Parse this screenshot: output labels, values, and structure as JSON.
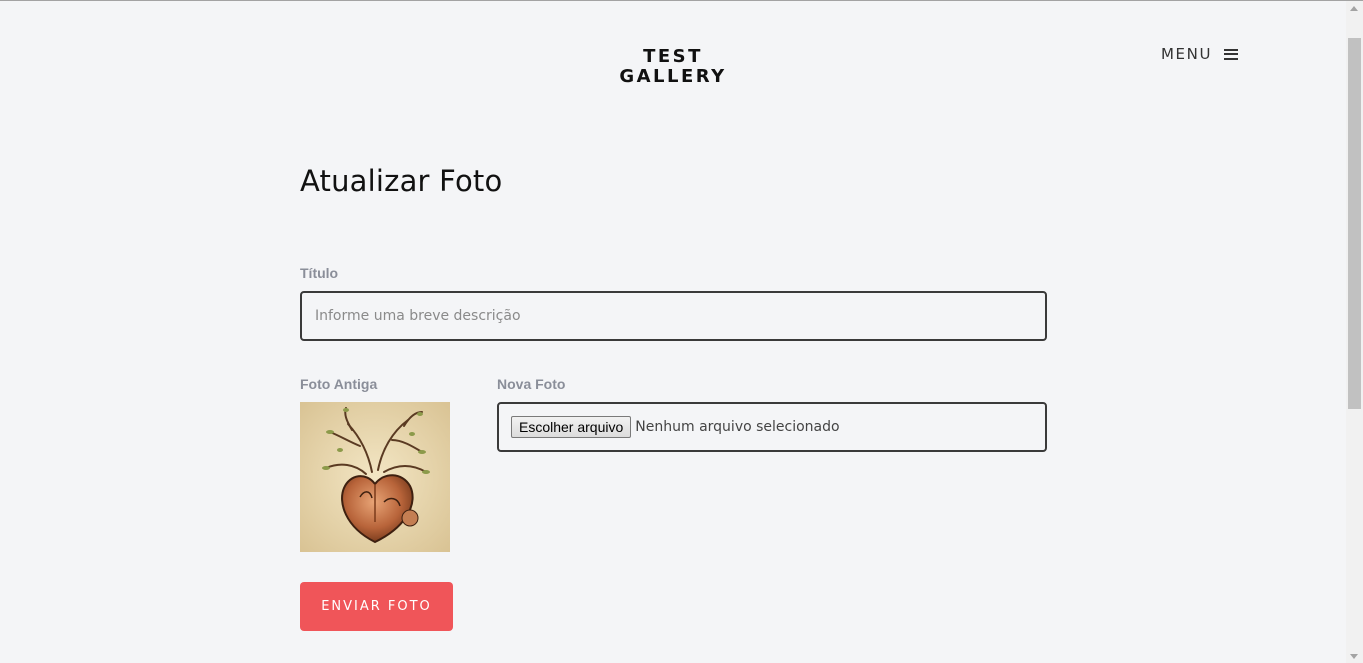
{
  "header": {
    "logo_line1": "TEST",
    "logo_line2": "GALLERY",
    "menu_label": "MENU",
    "menu_icon": "hamburger-menu-icon"
  },
  "main": {
    "page_title": "Atualizar Foto",
    "titulo_label": "Título",
    "titulo_placeholder": "Informe uma breve descrição",
    "titulo_value": "",
    "foto_antiga_label": "Foto Antiga",
    "nova_foto_label": "Nova Foto",
    "file_button_label": "Escolher arquivo",
    "file_status": "Nenhum arquivo selecionado",
    "submit_label": "ENVIAR FOTO"
  },
  "colors": {
    "background": "#f4f5f7",
    "accent": "#f05559",
    "label": "#8a8e99"
  }
}
